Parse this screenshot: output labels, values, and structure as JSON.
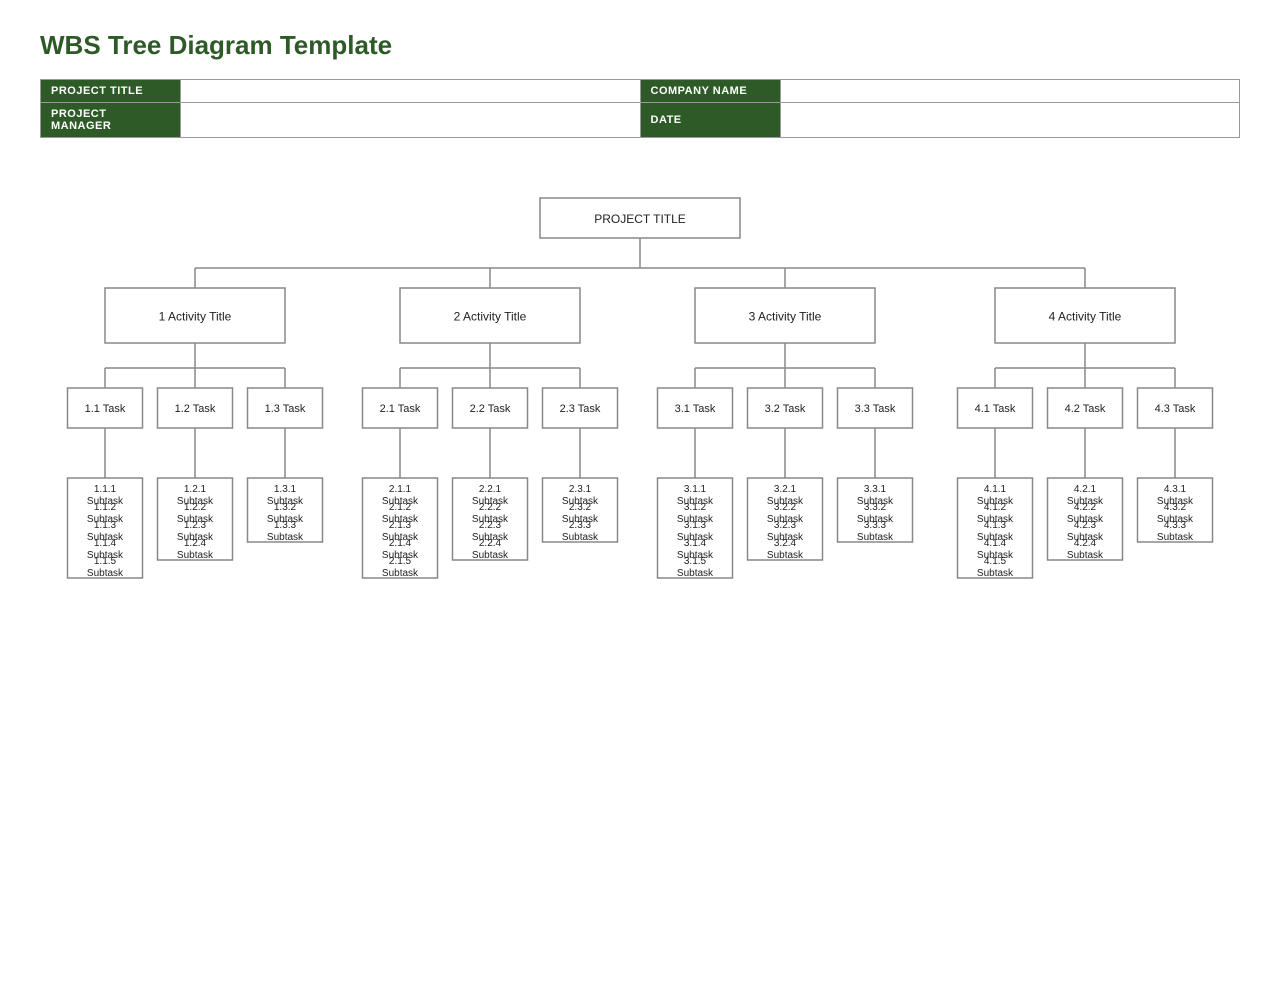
{
  "title": "WBS Tree Diagram Template",
  "info": {
    "project_title_label": "PROJECT TITLE",
    "project_title_value": "",
    "company_name_label": "COMPANY NAME",
    "company_name_value": "",
    "project_manager_label": "PROJECT MANAGER",
    "project_manager_value": "",
    "date_label": "DATE",
    "date_value": ""
  },
  "tree": {
    "root": "PROJECT TITLE",
    "activities": [
      {
        "label": "1 Activity Title",
        "tasks": [
          {
            "label": "1.1 Task",
            "subtasks": [
              "1.1.1 Subtask",
              "1.1.2 Subtask",
              "1.1.3 Subtask",
              "1.1.4 Subtask",
              "1.1.5 Subtask"
            ]
          },
          {
            "label": "1.2 Task",
            "subtasks": [
              "1.2.1 Subtask",
              "1.2.2 Subtask",
              "1.2.3 Subtask",
              "1.2.4 Subtask"
            ]
          },
          {
            "label": "1.3 Task",
            "subtasks": [
              "1.3.1 Subtask",
              "1.3.2 Subtask",
              "1.3.3 Subtask"
            ]
          }
        ]
      },
      {
        "label": "2 Activity Title",
        "tasks": [
          {
            "label": "2.1 Task",
            "subtasks": [
              "2.1.1 Subtask",
              "2.1.2 Subtask",
              "2.1.3 Subtask",
              "2.1.4 Subtask",
              "2.1.5 Subtask"
            ]
          },
          {
            "label": "2.2 Task",
            "subtasks": [
              "2.2.1 Subtask",
              "2.2.2 Subtask",
              "2.2.3 Subtask",
              "2.2.4 Subtask"
            ]
          },
          {
            "label": "2.3 Task",
            "subtasks": [
              "2.3.1 Subtask",
              "2.3.2 Subtask",
              "2.3.3 Subtask"
            ]
          }
        ]
      },
      {
        "label": "3 Activity Title",
        "tasks": [
          {
            "label": "3.1 Task",
            "subtasks": [
              "3.1.1 Subtask",
              "3.1.2 Subtask",
              "3.1.3 Subtask",
              "3.1.4 Subtask",
              "3.1.5 Subtask"
            ]
          },
          {
            "label": "3.2 Task",
            "subtasks": [
              "3.2.1 Subtask",
              "3.2.2 Subtask",
              "3.2.3 Subtask",
              "3.2.4 Subtask"
            ]
          },
          {
            "label": "3.3 Task",
            "subtasks": [
              "3.3.1 Subtask",
              "3.3.2 Subtask",
              "3.3.3 Subtask"
            ]
          }
        ]
      },
      {
        "label": "4 Activity Title",
        "tasks": [
          {
            "label": "4.1 Task",
            "subtasks": [
              "4.1.1 Subtask",
              "4.1.2 Subtask",
              "4.1.3 Subtask",
              "4.1.4 Subtask",
              "4.1.5 Subtask"
            ]
          },
          {
            "label": "4.2 Task",
            "subtasks": [
              "4.2.1 Subtask",
              "4.2.2 Subtask",
              "4.2.3 Subtask",
              "4.2.4 Subtask"
            ]
          },
          {
            "label": "4.3 Task",
            "subtasks": [
              "4.3.1 Subtask",
              "4.3.2 Subtask",
              "4.3.3 Subtask"
            ]
          }
        ]
      }
    ]
  },
  "colors": {
    "dark_green": "#2d5a27",
    "border": "#888888"
  }
}
